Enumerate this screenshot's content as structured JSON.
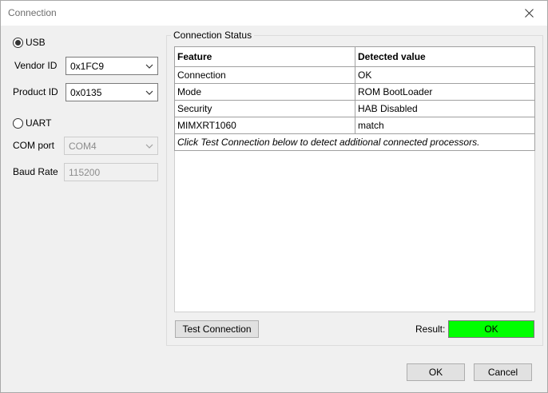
{
  "window": {
    "title": "Connection"
  },
  "left": {
    "usb_label": "USB",
    "usb_selected": true,
    "vendor_id_label": "Vendor ID",
    "vendor_id_value": "0x1FC9",
    "product_id_label": "Product ID",
    "product_id_value": "0x0135",
    "uart_label": "UART",
    "uart_selected": false,
    "com_port_label": "COM port",
    "com_port_value": "COM4",
    "baud_rate_label": "Baud Rate",
    "baud_rate_value": "115200"
  },
  "status": {
    "group_title": "Connection Status",
    "columns": [
      "Feature",
      "Detected value"
    ],
    "rows": [
      [
        "Connection",
        "OK"
      ],
      [
        "Mode",
        "ROM BootLoader"
      ],
      [
        "Security",
        "HAB Disabled"
      ],
      [
        "MIMXRT1060",
        "match"
      ]
    ],
    "note": "Click Test Connection below to detect additional connected processors.",
    "test_button": "Test Connection",
    "result_label": "Result:",
    "result_value": "OK",
    "result_color": "#00ff00"
  },
  "footer": {
    "ok_label": "OK",
    "cancel_label": "Cancel"
  },
  "icons": {
    "close": "close-icon",
    "chevron": "chevron-down-icon"
  }
}
